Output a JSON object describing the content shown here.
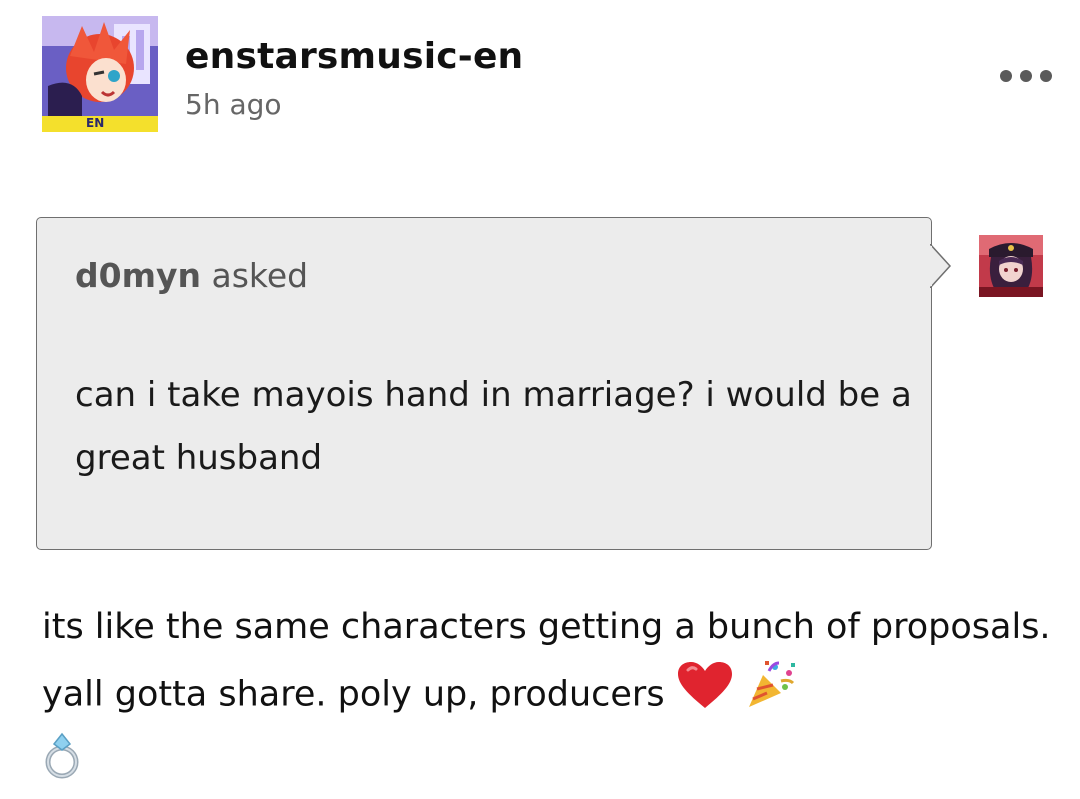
{
  "post": {
    "blog_name": "enstarsmusic-en",
    "timestamp": "5h ago",
    "avatar_badge": "EN",
    "more_icon": "more-horizontal-icon"
  },
  "ask": {
    "asker_name": "d0myn",
    "asked_label": "asked",
    "question": "can i take mayois hand in marriage? i would be a great husband"
  },
  "answer": {
    "text": "its like the same characters getting a bunch of proposals. yall gotta share. poly up, producers",
    "emojis": [
      "red-heart-icon",
      "party-popper-icon",
      "ring-icon"
    ]
  },
  "colors": {
    "bubble_bg": "#ececec",
    "bubble_border": "#6f6f6f",
    "muted_text": "#666666",
    "heart": "#e0242f"
  }
}
